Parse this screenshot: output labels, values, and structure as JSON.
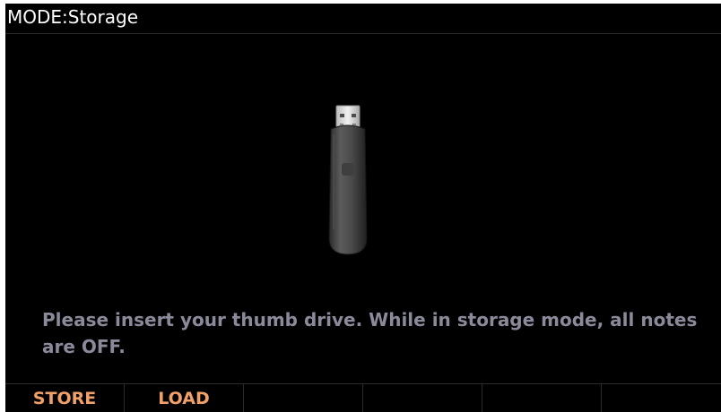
{
  "header": {
    "title": "MODE:Storage"
  },
  "main": {
    "illustration_icon": "usb-thumb-drive-icon",
    "message": "Please insert your thumb drive. While in storage mode, all notes are OFF."
  },
  "softkeys": [
    {
      "label": "STORE"
    },
    {
      "label": "LOAD"
    },
    {
      "label": ""
    },
    {
      "label": ""
    },
    {
      "label": ""
    },
    {
      "label": ""
    }
  ],
  "colors": {
    "background": "#000000",
    "title_text": "#ffffff",
    "message_text": "#8a8a9a",
    "softkey_text": "#f0a068",
    "divider": "#2b2b2b"
  }
}
